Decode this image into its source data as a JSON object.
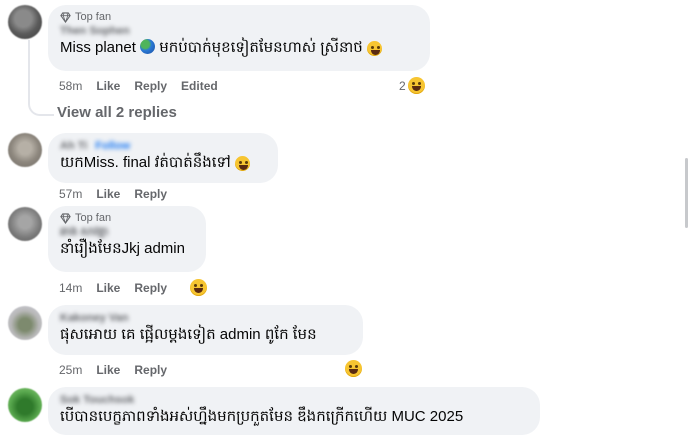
{
  "comments": [
    {
      "badge": "Top fan",
      "author": "Then Sophen",
      "text_before_globe": "Miss planet",
      "text_after_globe": "មកប់បាក់មុខទៀតមែនហាស់ ស្រីនាថ",
      "time": "58m",
      "like": "Like",
      "reply": "Reply",
      "edited": "Edited",
      "reaction_count": "2"
    },
    {
      "author": "Ah Ti",
      "follow": "Follow",
      "text": "យកMiss. final វត់បាត់នឹងទៅ",
      "time": "57m",
      "like": "Like",
      "reply": "Reply"
    },
    {
      "badge": "Top fan",
      "author": "ឆាង សាវត្តា",
      "text": "នាំរឿងមែនJkj admin",
      "time": "14m",
      "like": "Like",
      "reply": "Reply"
    },
    {
      "author": "Kakoney Van",
      "text": "ផុសអោយ គេ ផ្អើលម្តងទៀត admin ពូកែ មែន",
      "time": "25m",
      "like": "Like",
      "reply": "Reply"
    },
    {
      "author": "Sok Touchsok",
      "text": "បើបានបេក្ខភាពទាំងអស់ហ្នឹងមកប្រកួតមែន ឌឹងកក្រើកហើយ MUC 2025"
    }
  ],
  "view_replies": "View all 2 replies",
  "icons": {
    "badge": "diamond-icon",
    "globe": "globe-emoji-icon",
    "laugh": "laughing-emoji-icon"
  }
}
